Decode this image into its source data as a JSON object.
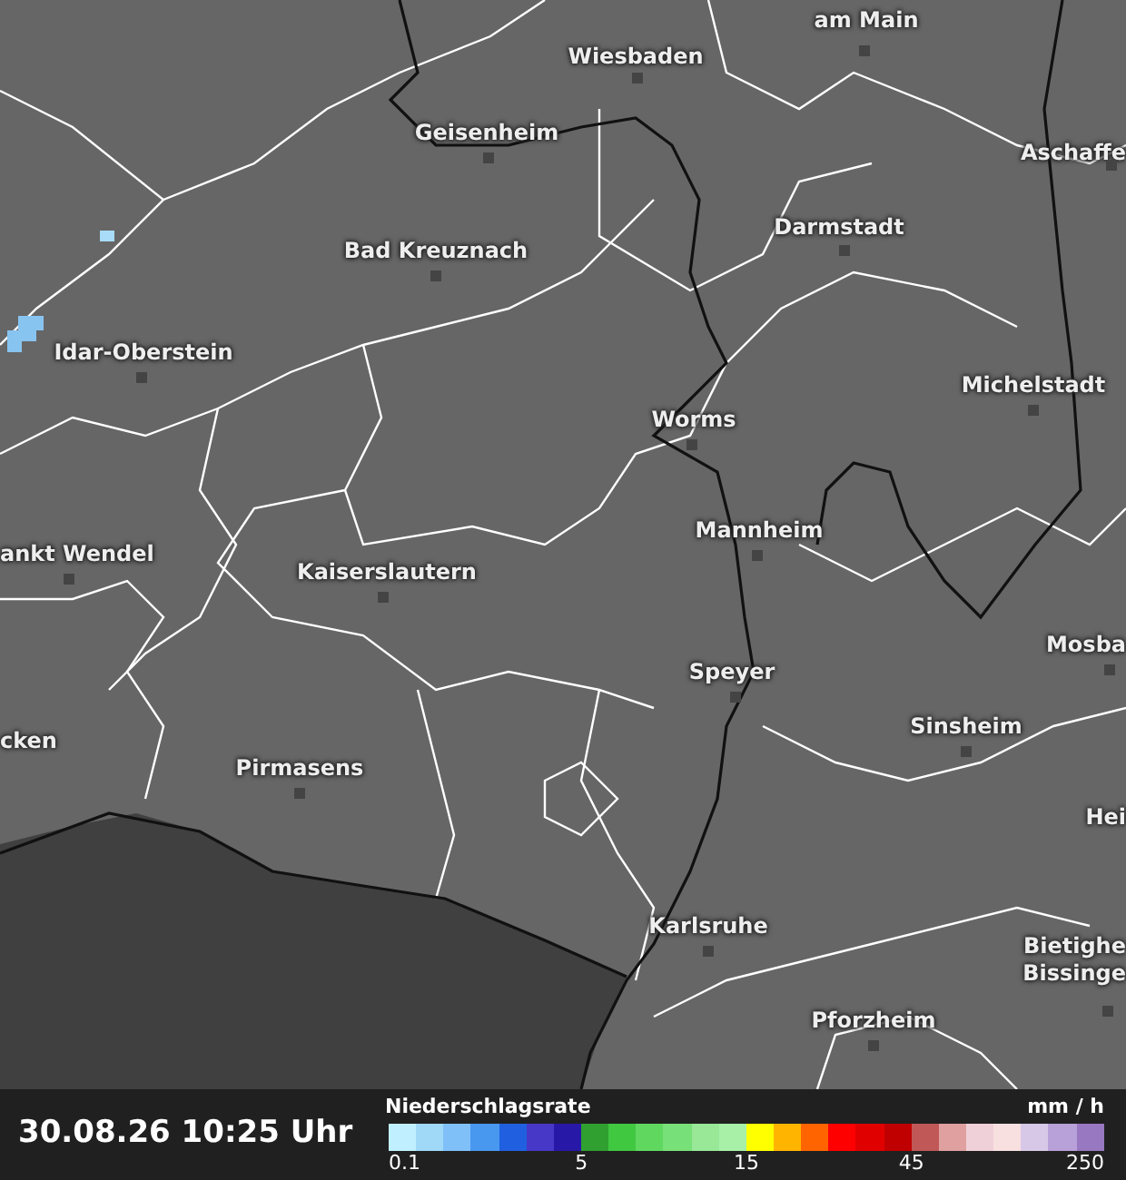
{
  "cities": [
    {
      "name": "am Main"
    },
    {
      "name": "Wiesbaden"
    },
    {
      "name": "Geisenheim"
    },
    {
      "name": "Aschaffe"
    },
    {
      "name": "Darmstadt"
    },
    {
      "name": "Bad Kreuznach"
    },
    {
      "name": "Idar-Oberstein"
    },
    {
      "name": "Michelstadt"
    },
    {
      "name": "Worms"
    },
    {
      "name": "Mannheim"
    },
    {
      "name": "ankt Wendel"
    },
    {
      "name": "Kaiserslautern"
    },
    {
      "name": "Mosba"
    },
    {
      "name": "Speyer"
    },
    {
      "name": "Sinsheim"
    },
    {
      "name": "cken"
    },
    {
      "name": "Pirmasens"
    },
    {
      "name": "Hei"
    },
    {
      "name": "Karlsruhe"
    },
    {
      "name": "Bietighe"
    },
    {
      "name": "Bissinge"
    },
    {
      "name": "Pforzheim"
    }
  ],
  "timestamp": "30.08.26 10:25 Uhr",
  "legend": {
    "title": "Niederschlagsrate",
    "unit": "mm / h",
    "swatches": [
      {
        "color": "#c0f0ff"
      },
      {
        "color": "#a0d8f8"
      },
      {
        "color": "#80c0f8"
      },
      {
        "color": "#4898f0"
      },
      {
        "color": "#2060e0"
      },
      {
        "color": "#4838c8"
      },
      {
        "color": "#2818a8"
      },
      {
        "color": "#30a030"
      },
      {
        "color": "#40c840"
      },
      {
        "color": "#60d860"
      },
      {
        "color": "#78e078"
      },
      {
        "color": "#98e898"
      },
      {
        "color": "#a8f0a8"
      },
      {
        "color": "#ffff00"
      },
      {
        "color": "#ffb400"
      },
      {
        "color": "#ff6400"
      },
      {
        "color": "#ff0000"
      },
      {
        "color": "#e00000"
      },
      {
        "color": "#c00000"
      },
      {
        "color": "#c05858"
      },
      {
        "color": "#e0a0a0"
      },
      {
        "color": "#f0d0d8"
      },
      {
        "color": "#f8e0e0"
      },
      {
        "color": "#d8c8e8"
      },
      {
        "color": "#b8a0d8"
      },
      {
        "color": "#9878c0"
      }
    ],
    "ticks": [
      {
        "label": "0.1"
      },
      {
        "label": "5"
      },
      {
        "label": "15"
      },
      {
        "label": "45"
      },
      {
        "label": "250"
      }
    ]
  }
}
